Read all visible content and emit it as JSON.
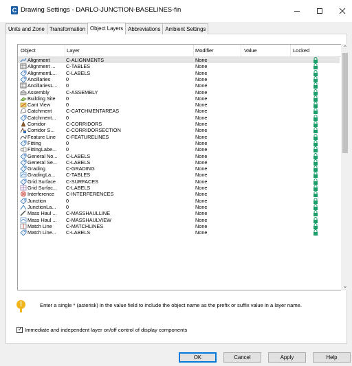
{
  "window": {
    "title": "Drawing Settings - DARLO-JUNCTION-BASELINES-fin",
    "app_icon_letter": "C"
  },
  "tabs": [
    {
      "label": "Units and Zone"
    },
    {
      "label": "Transformation"
    },
    {
      "label": "Object Layers"
    },
    {
      "label": "Abbreviations"
    },
    {
      "label": "Ambient Settings"
    }
  ],
  "grid": {
    "columns": [
      "Object",
      "Layer",
      "Modifier",
      "Value",
      "Locked"
    ],
    "rows": [
      {
        "object": "Alignment",
        "layer": "C-ALIGNMENTS",
        "modifier": "None",
        "icon": "alignment-icon"
      },
      {
        "object": "Alignment ...",
        "layer": "C-TABLES",
        "modifier": "None",
        "icon": "table-icon"
      },
      {
        "object": "AlignmentL...",
        "layer": "C-LABELS",
        "modifier": "None",
        "icon": "label-icon"
      },
      {
        "object": "Ancillaries",
        "layer": "0",
        "modifier": "None",
        "icon": "label-icon"
      },
      {
        "object": "AncillariesL...",
        "layer": "0",
        "modifier": "None",
        "icon": "table-icon"
      },
      {
        "object": "Assembly",
        "layer": "C-ASSEMBLY",
        "modifier": "None",
        "icon": "assembly-icon"
      },
      {
        "object": "Building Site",
        "layer": "0",
        "modifier": "None",
        "icon": "building-site-icon"
      },
      {
        "object": "Cant View",
        "layer": "0",
        "modifier": "None",
        "icon": "cant-view-icon"
      },
      {
        "object": "Catchment",
        "layer": "C-CATCHMENTAREAS",
        "modifier": "None",
        "icon": "catchment-icon"
      },
      {
        "object": "Catchment...",
        "layer": "0",
        "modifier": "None",
        "icon": "label-icon"
      },
      {
        "object": "Corridor",
        "layer": "C-CORRIDORS",
        "modifier": "None",
        "icon": "corridor-icon"
      },
      {
        "object": "Corridor S...",
        "layer": "C-CORRIDORSECTION",
        "modifier": "None",
        "icon": "corridor-section-icon"
      },
      {
        "object": "Feature Line",
        "layer": "C-FEATURELINES",
        "modifier": "None",
        "icon": "feature-line-icon"
      },
      {
        "object": "Fitting",
        "layer": "0",
        "modifier": "None",
        "icon": "label-icon"
      },
      {
        "object": "FittingLabe...",
        "layer": "0",
        "modifier": "None",
        "icon": "fitting-label-icon"
      },
      {
        "object": "General No...",
        "layer": "C-LABELS",
        "modifier": "None",
        "icon": "label-icon"
      },
      {
        "object": "General Se...",
        "layer": "C-LABELS",
        "modifier": "None",
        "icon": "label-icon"
      },
      {
        "object": "Grading",
        "layer": "C-GRADING",
        "modifier": "None",
        "icon": "label-icon"
      },
      {
        "object": "GradingLa...",
        "layer": "C-TABLES",
        "modifier": "None",
        "icon": "grading-label-icon"
      },
      {
        "object": "Grid Surface",
        "layer": "C-SURFACES",
        "modifier": "None",
        "icon": "label-icon"
      },
      {
        "object": "Grid Surfac...",
        "layer": "C-LABELS",
        "modifier": "None",
        "icon": "grid-surface-label-icon"
      },
      {
        "object": "Interference",
        "layer": "C-INTERFERENCES",
        "modifier": "None",
        "icon": "interference-icon"
      },
      {
        "object": "Junction",
        "layer": "0",
        "modifier": "None",
        "icon": "label-icon"
      },
      {
        "object": "JunctionLa...",
        "layer": "0",
        "modifier": "None",
        "icon": "junction-label-icon"
      },
      {
        "object": "Mass Haul ...",
        "layer": "C-MASSHAULLINE",
        "modifier": "None",
        "icon": "mass-haul-line-icon"
      },
      {
        "object": "Mass Haul ...",
        "layer": "C-MASSHAULVIEW",
        "modifier": "None",
        "icon": "mass-haul-view-icon"
      },
      {
        "object": "Match Line",
        "layer": "C-MATCHLINES",
        "modifier": "None",
        "icon": "match-line-icon"
      },
      {
        "object": "Match Line...",
        "layer": "C-LABELS",
        "modifier": "None",
        "icon": "label-icon"
      }
    ]
  },
  "note": "Enter a single * (asterisk) in the value field to include the object name as the prefix or suffix value in a layer name.",
  "checkbox": {
    "label": "Immediate and independent layer on/off control of display components",
    "checked": true
  },
  "buttons": {
    "ok": "OK",
    "cancel": "Cancel",
    "apply": "Apply",
    "help": "Help"
  },
  "colors": {
    "accent": "#0078d7",
    "lock_icon": "#1e9e6a",
    "warning": "#f1b51c"
  }
}
